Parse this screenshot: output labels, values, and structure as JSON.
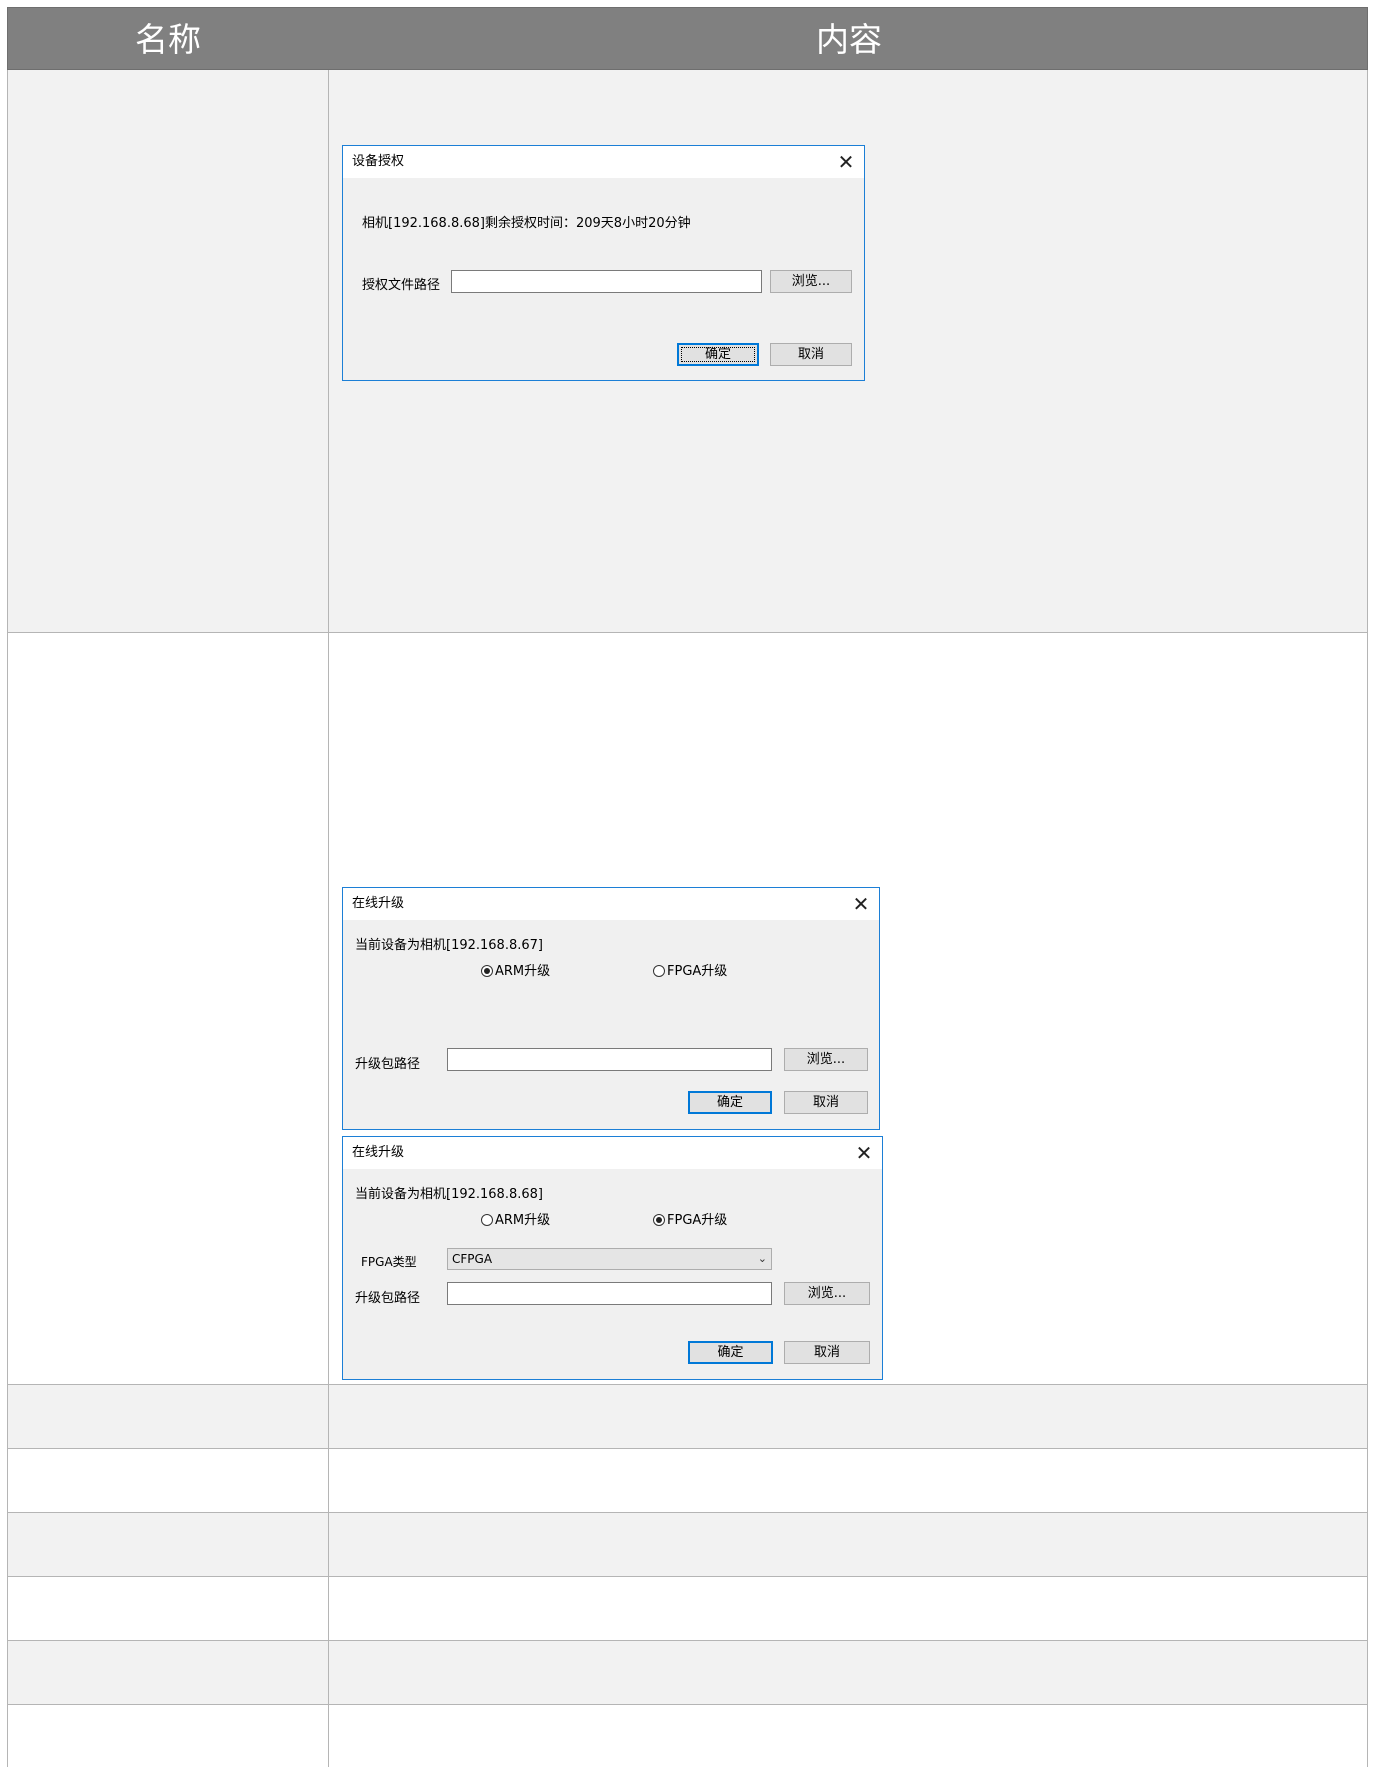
{
  "table": {
    "header": {
      "name_col": "名称",
      "content_col": "内容"
    }
  },
  "auth_dialog": {
    "title": "设备授权",
    "close_glyph": "✕",
    "remaining_text": "相机[192.168.8.68]剩余授权时间：209天8小时20分钟",
    "path_label": "授权文件路径",
    "path_value": "",
    "browse_label": "浏览...",
    "ok_label": "确定",
    "cancel_label": "取消"
  },
  "upgrade_dialog_arm": {
    "title": "在线升级",
    "close_glyph": "✕",
    "device_text": "当前设备为相机[192.168.8.67]",
    "radio_arm_label": "ARM升级",
    "radio_fpga_label": "FPGA升级",
    "selected": "ARM升级",
    "path_label": "升级包路径",
    "path_value": "",
    "browse_label": "浏览...",
    "ok_label": "确定",
    "cancel_label": "取消"
  },
  "upgrade_dialog_fpga": {
    "title": "在线升级",
    "close_glyph": "✕",
    "device_text": "当前设备为相机[192.168.8.68]",
    "radio_arm_label": "ARM升级",
    "radio_fpga_label": "FPGA升级",
    "selected": "FPGA升级",
    "fpga_type_label": "FPGA类型",
    "fpga_type_value": "CFPGA",
    "path_label": "升级包路径",
    "path_value": "",
    "browse_label": "浏览...",
    "ok_label": "确定",
    "cancel_label": "取消"
  }
}
